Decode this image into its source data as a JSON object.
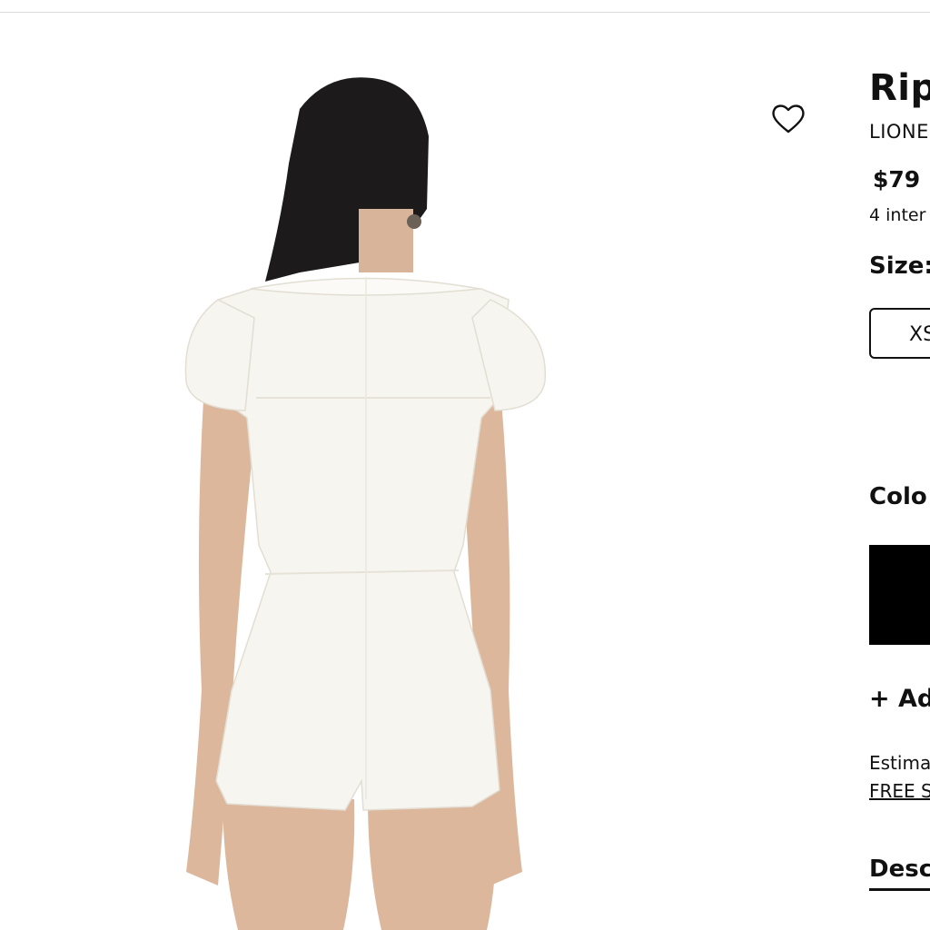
{
  "product": {
    "title": "Rip",
    "brand": "LIONE",
    "price": "$79",
    "installments": "4 inter",
    "size_label": "Size:",
    "size_option": "XS",
    "color_label": "Colo",
    "color_swatch": "#000000",
    "add_link": "+ Ad",
    "estimated": "Estima",
    "free_shipping": "FREE SH",
    "description_tab": "Desc"
  },
  "icons": {
    "wishlist": "heart-outline-icon"
  }
}
